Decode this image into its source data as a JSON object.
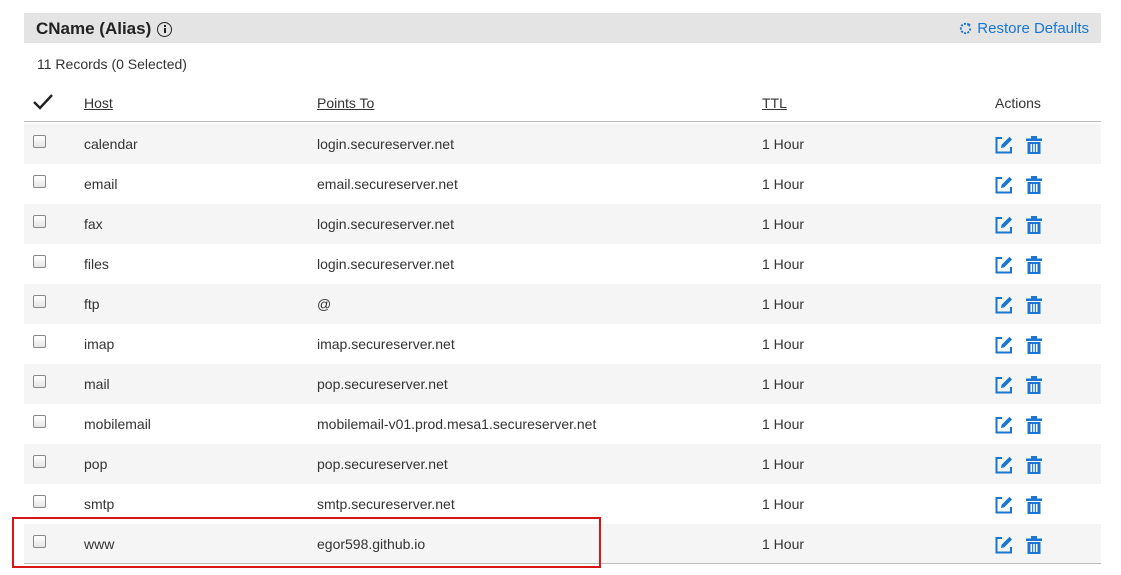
{
  "header": {
    "title": "CName (Alias)",
    "restore_label": "Restore Defaults"
  },
  "records_summary": "11 Records (0 Selected)",
  "columns": {
    "host": "Host",
    "points_to": "Points To",
    "ttl": "TTL",
    "actions": "Actions"
  },
  "rows": [
    {
      "host": "calendar",
      "points_to": "login.secureserver.net",
      "ttl": "1 Hour"
    },
    {
      "host": "email",
      "points_to": "email.secureserver.net",
      "ttl": "1 Hour"
    },
    {
      "host": "fax",
      "points_to": "login.secureserver.net",
      "ttl": "1 Hour"
    },
    {
      "host": "files",
      "points_to": "login.secureserver.net",
      "ttl": "1 Hour"
    },
    {
      "host": "ftp",
      "points_to": "@",
      "ttl": "1 Hour"
    },
    {
      "host": "imap",
      "points_to": "imap.secureserver.net",
      "ttl": "1 Hour"
    },
    {
      "host": "mail",
      "points_to": "pop.secureserver.net",
      "ttl": "1 Hour"
    },
    {
      "host": "mobilemail",
      "points_to": "mobilemail-v01.prod.mesa1.secureserver.net",
      "ttl": "1 Hour"
    },
    {
      "host": "pop",
      "points_to": "pop.secureserver.net",
      "ttl": "1 Hour"
    },
    {
      "host": "smtp",
      "points_to": "smtp.secureserver.net",
      "ttl": "1 Hour"
    },
    {
      "host": "www",
      "points_to": "egor598.github.io",
      "ttl": "1 Hour"
    }
  ],
  "icons": {
    "info": "info-icon",
    "restore": "refresh-icon",
    "select_all": "checkmark-icon",
    "edit": "edit-icon",
    "delete": "trash-icon"
  },
  "colors": {
    "accent": "#1976d2",
    "header_bg": "#e4e4e4",
    "highlight": "#d81616"
  }
}
